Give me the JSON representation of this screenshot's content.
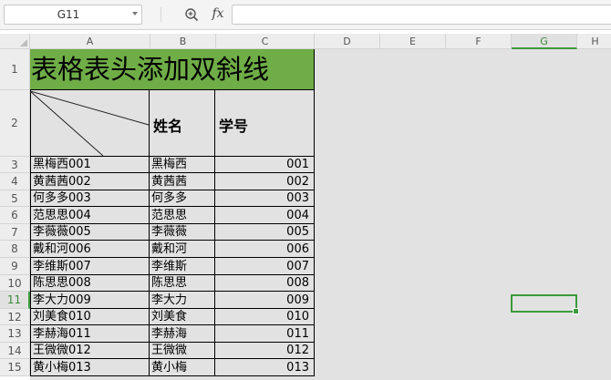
{
  "formula_bar": {
    "cell_ref": "G11",
    "fx_label": "fx",
    "formula_value": ""
  },
  "columns": [
    "A",
    "B",
    "C",
    "D",
    "E",
    "F",
    "G",
    "H"
  ],
  "selected_column": "G",
  "rows": [
    "1",
    "2",
    "3",
    "4",
    "5",
    "6",
    "7",
    "8",
    "9",
    "10",
    "11",
    "12",
    "13",
    "14",
    "15"
  ],
  "selected_row": "11",
  "sheet": {
    "title": "表格表头添加双斜线",
    "header_b": "姓名",
    "header_c": "学号",
    "records": [
      {
        "a": "黑梅西001",
        "b": "黑梅西",
        "c": "001"
      },
      {
        "a": "黄茜茜002",
        "b": "黄茜茜",
        "c": "002"
      },
      {
        "a": "何多多003",
        "b": "何多多",
        "c": "003"
      },
      {
        "a": "范思思004",
        "b": "范思思",
        "c": "004"
      },
      {
        "a": "李薇薇005",
        "b": "李薇薇",
        "c": "005"
      },
      {
        "a": "戴和河006",
        "b": "戴和河",
        "c": "006"
      },
      {
        "a": "李维斯007",
        "b": "李维斯",
        "c": "007"
      },
      {
        "a": "陈思思008",
        "b": "陈思思",
        "c": "008"
      },
      {
        "a": "李大力009",
        "b": "李大力",
        "c": "009"
      },
      {
        "a": "刘美食010",
        "b": "刘美食",
        "c": "010"
      },
      {
        "a": "李赫海011",
        "b": "李赫海",
        "c": "011"
      },
      {
        "a": "王微微012",
        "b": "王微微",
        "c": "012"
      },
      {
        "a": "黄小梅013",
        "b": "黄小梅",
        "c": "013"
      }
    ]
  },
  "colors": {
    "title_fill": "#6fad47",
    "selection": "#3c9a3c"
  }
}
